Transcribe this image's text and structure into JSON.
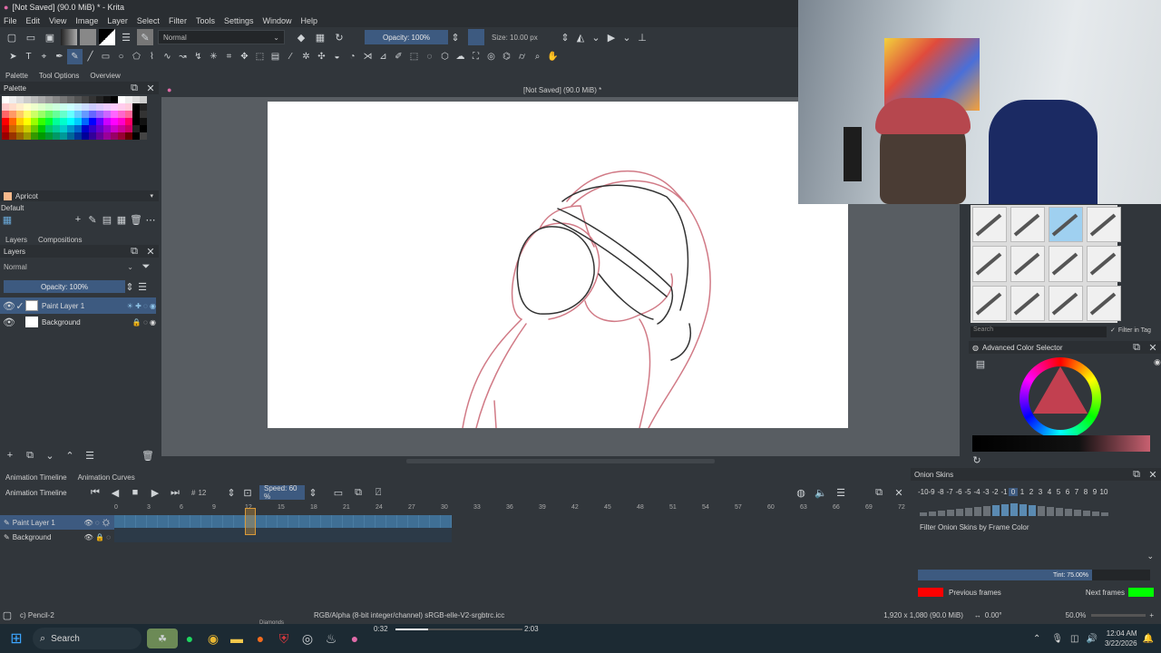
{
  "window_title": "[Not Saved] (90.0 MiB) * - Krita",
  "menu": [
    "File",
    "Edit",
    "View",
    "Image",
    "Layer",
    "Select",
    "Filter",
    "Tools",
    "Settings",
    "Window",
    "Help"
  ],
  "toolbar": {
    "blend_mode": "Normal",
    "opacity": "Opacity: 100%",
    "size": "Size: 10.00 px"
  },
  "doc_title": "[Not Saved] (90.0 MiB) *",
  "left_tabs": [
    "Palette",
    "Tool Options",
    "Overview"
  ],
  "palette": {
    "title": "Palette",
    "selected_color_name": "Apricot",
    "palette_name": "Default"
  },
  "layers_panel": {
    "tabs": [
      "Layers",
      "Compositions"
    ],
    "title": "Layers",
    "blend_mode": "Normal",
    "opacity": "Opacity: 100%",
    "layers": [
      {
        "name": "Paint Layer 1"
      },
      {
        "name": "Background"
      }
    ]
  },
  "timeline": {
    "tabs": [
      "Animation Timeline",
      "Animation Curves"
    ],
    "title": "Animation Timeline",
    "frame": "12",
    "speed": "Speed: 60 %",
    "ruler": [
      "0",
      "3",
      "6",
      "9",
      "12",
      "15",
      "18",
      "21",
      "24",
      "27",
      "30",
      "33",
      "36",
      "39",
      "42",
      "45",
      "48",
      "51",
      "54",
      "57",
      "60",
      "63",
      "66",
      "69",
      "72"
    ],
    "layers": [
      "Paint Layer 1",
      "Background"
    ]
  },
  "onion": {
    "title": "Onion Skins",
    "numbers": [
      "-10",
      "-9",
      "-8",
      "-7",
      "-6",
      "-5",
      "-4",
      "-3",
      "-2",
      "-1",
      "0",
      "1",
      "2",
      "3",
      "4",
      "5",
      "6",
      "7",
      "8",
      "9",
      "10"
    ],
    "filter_label": "Filter Onion Skins by Frame Color",
    "tint": "Tint: 75.00%",
    "previous_label": "Previous frames",
    "next_label": "Next frames",
    "previous_color": "#ff0000",
    "next_color": "#00ff00"
  },
  "brush_search_placeholder": "Search",
  "filter_in_tag": "Filter in Tag",
  "color_selector_title": "Advanced Color Selector",
  "status": {
    "brush": "c) Pencil-2",
    "color_space": "RGB/Alpha (8-bit integer/channel)  sRGB-elle-V2-srgbtrc.icc",
    "dimensions": "1,920 x 1,080 (90.0 MiB)",
    "rotation": "0.00°",
    "zoom": "50.0%"
  },
  "taskbar": {
    "search": "Search",
    "media_label": "Diamonds",
    "media_elapsed": "0:32",
    "media_total": "2:03",
    "media_progress": 0.26,
    "time": "12:04 AM",
    "date": "3/22/2026"
  },
  "accent": "#3daee9"
}
